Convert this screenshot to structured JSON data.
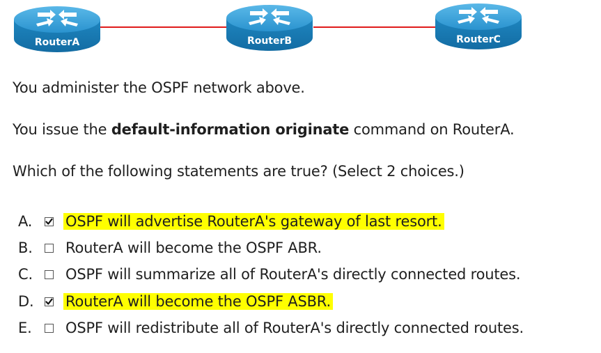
{
  "topology": {
    "routers": [
      {
        "id": "a",
        "name": "RouterA"
      },
      {
        "id": "b",
        "name": "RouterB"
      },
      {
        "id": "c",
        "name": "RouterC"
      }
    ],
    "link_color": "#e01b1b",
    "router_color": "#1e8fc8"
  },
  "question": {
    "line1": "You administer the OSPF network above.",
    "line2_pre": "You issue the ",
    "line2_cmd": "default-information originate",
    "line2_post": " command on RouterA.",
    "line3": "Which of the following statements are true?  (Select 2 choices.)"
  },
  "choices": [
    {
      "letter": "A.",
      "text": "OSPF will advertise RouterA's gateway of last resort.",
      "checked": true,
      "highlighted": true
    },
    {
      "letter": "B.",
      "text": "RouterA will become the OSPF ABR.",
      "checked": false,
      "highlighted": false
    },
    {
      "letter": "C.",
      "text": "OSPF will summarize all of RouterA's directly connected routes.",
      "checked": false,
      "highlighted": false
    },
    {
      "letter": "D.",
      "text": "RouterA will become the OSPF ASBR.",
      "checked": true,
      "highlighted": true
    },
    {
      "letter": "E.",
      "text": "OSPF will redistribute all of RouterA's directly connected routes.",
      "checked": false,
      "highlighted": false
    }
  ],
  "highlight_color": "#ffff00"
}
